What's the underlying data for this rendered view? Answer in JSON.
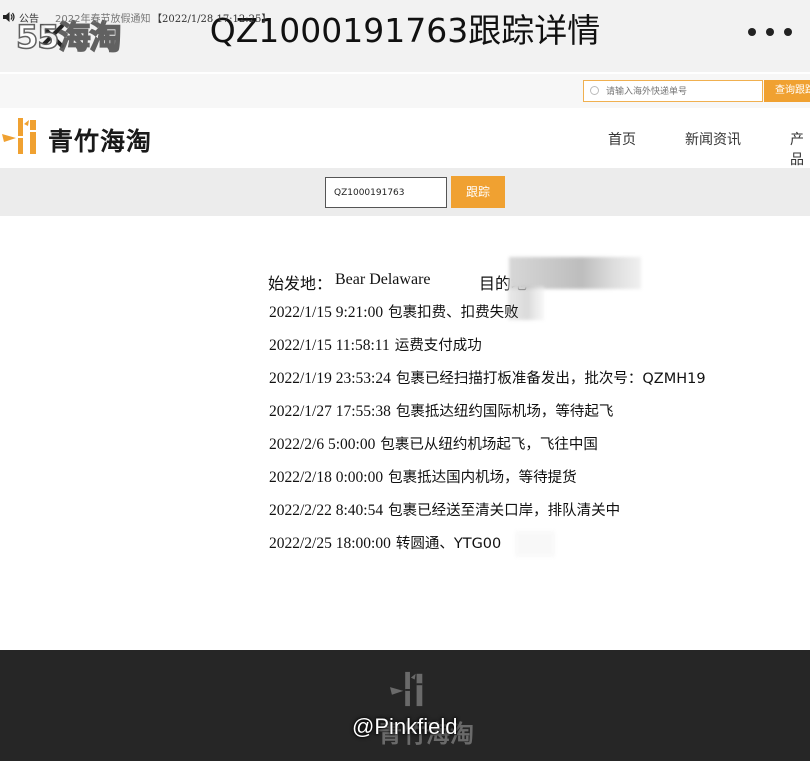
{
  "topbar": {
    "watermark": "55海淘",
    "title": "QZ1000191763跟踪详情"
  },
  "notice": {
    "label": "公告",
    "text": "2022年春节放假通知",
    "date": "【2022/1/28 17:12:25】",
    "search_placeholder": "请输入海外快递单号",
    "search_button": "查询跟踪"
  },
  "site": {
    "logo_text": "青竹海淘",
    "nav": [
      "首页",
      "新闻资讯",
      "产品"
    ]
  },
  "tracking": {
    "input_value": "QZ1000191763",
    "button": "跟踪",
    "origin_label": "始发地：",
    "origin_value": "Bear Delaware",
    "dest_label": "目的地",
    "events": [
      {
        "time": "2022/1/15 9:21:00",
        "desc": "包裹扣费、扣费失败"
      },
      {
        "time": "2022/1/15 11:58:11",
        "desc": "运费支付成功"
      },
      {
        "time": "2022/1/19 23:53:24",
        "desc": "包裹已经扫描打板准备发出，批次号：QZMH19"
      },
      {
        "time": "2022/1/27 17:55:38",
        "desc": "包裹抵达纽约国际机场，等待起飞"
      },
      {
        "time": "2022/2/6 5:00:00",
        "desc": "包裹已从纽约机场起飞，飞往中国"
      },
      {
        "time": "2022/2/18 0:00:00",
        "desc": "包裹抵达国内机场，等待提货"
      },
      {
        "time": "2022/2/22 8:40:54",
        "desc": "包裹已经送至清关口岸，排队清关中"
      },
      {
        "time": "2022/2/25 18:00:00",
        "desc": "转圆通、YTG00"
      }
    ]
  },
  "footer": {
    "logo_text": "青竹海淘",
    "handle": "@Pinkfield"
  },
  "colors": {
    "accent": "#f0a131",
    "footer_bg": "#262626",
    "logo_orange": "#f0a131"
  }
}
